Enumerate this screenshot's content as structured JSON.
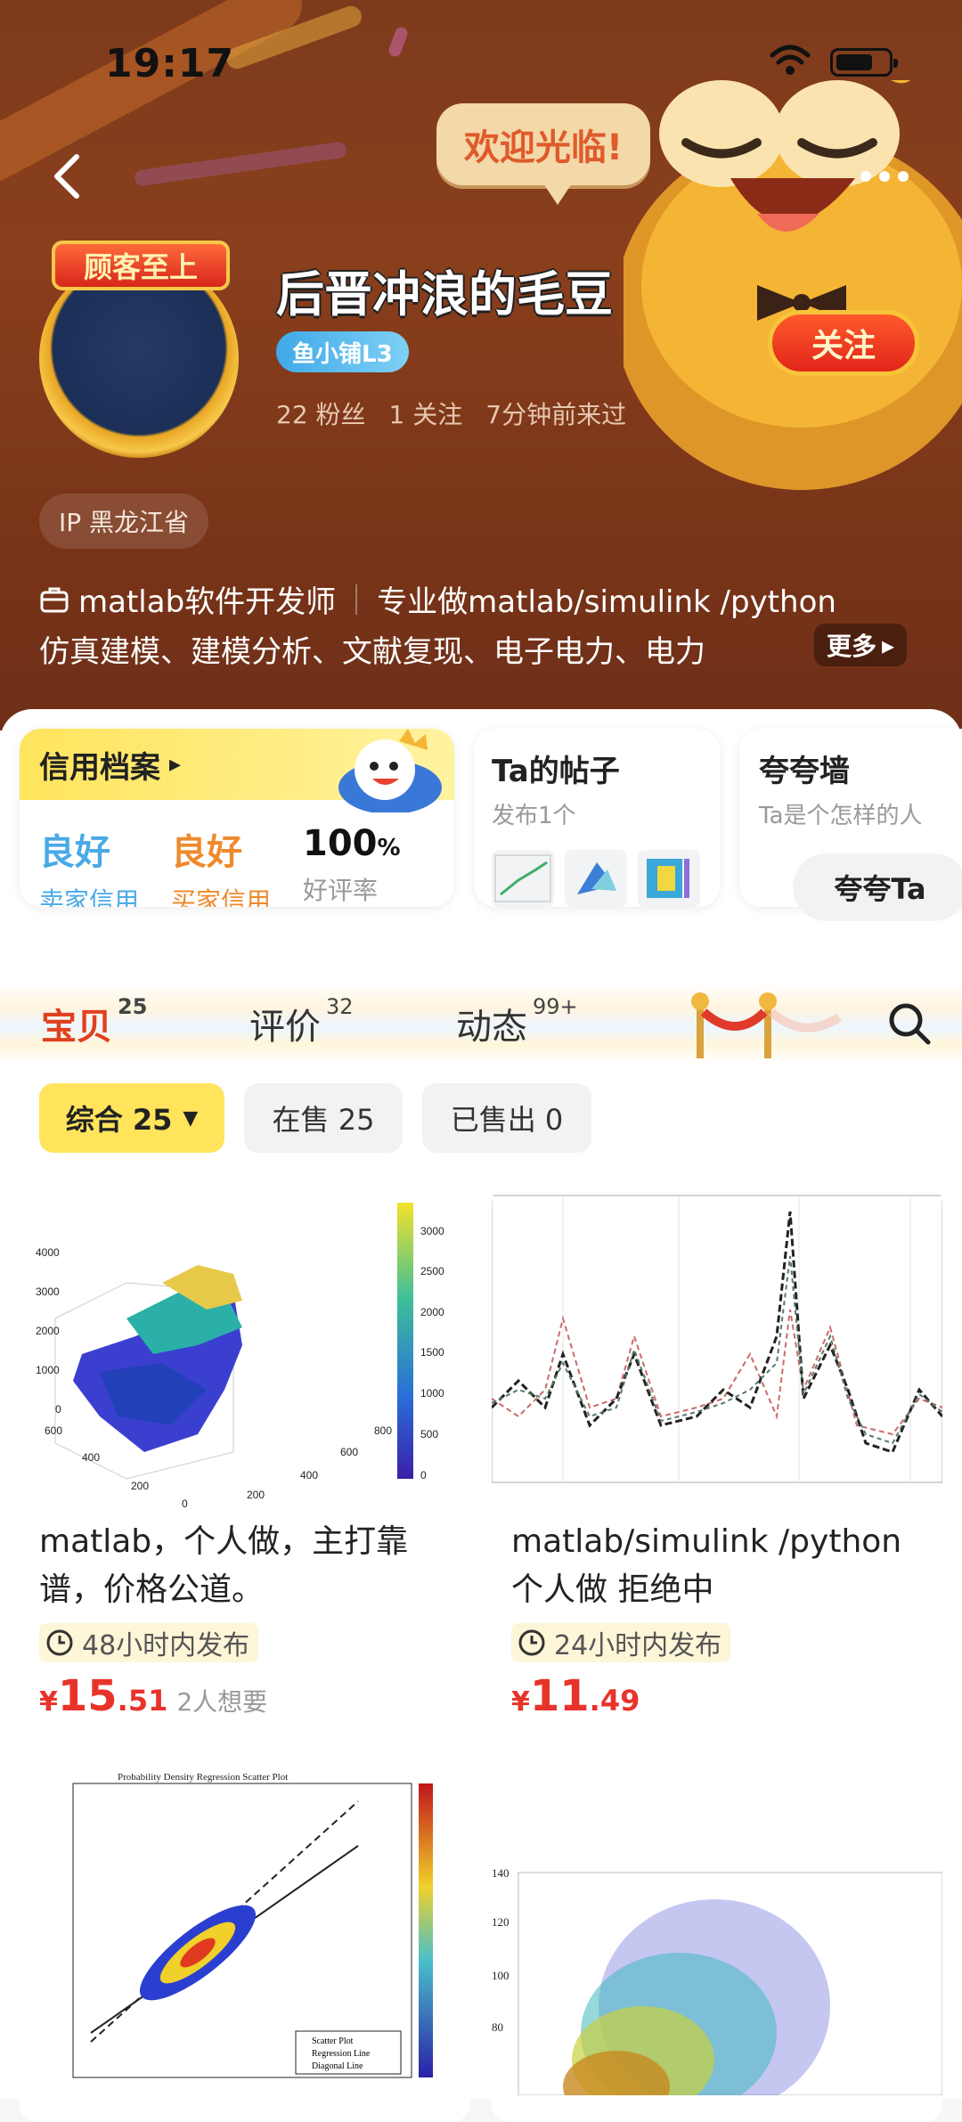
{
  "status_bar": {
    "time": "19:17"
  },
  "header": {
    "welcome": "欢迎光临!",
    "avatar_tag": "顾客至上",
    "nickname": "后晋冲浪的毛豆",
    "level": "鱼小铺L3",
    "follow": "关注",
    "stats": {
      "fans": "22 粉丝",
      "following": "1 关注",
      "last_seen": "7分钟前来过"
    },
    "ip": "IP 黑龙江省",
    "bio_job": "matlab软件开发师",
    "bio_line1": "专业做matlab/simulink /python",
    "bio_line2": "仿真建模、建模分析、文献复现、电子电力、电力",
    "more": "更多"
  },
  "cards": {
    "credit": {
      "title": "信用档案",
      "seller_value": "良好",
      "seller_label": "卖家信用",
      "buyer_value": "良好",
      "buyer_label": "买家信用",
      "rating_value": "100",
      "rating_unit": "%",
      "rating_label": "好评率",
      "colors": {
        "seller": "#4aa9e6",
        "buyer": "#ee8a2c"
      }
    },
    "posts": {
      "title": "Ta的帖子",
      "subtitle": "发布1个"
    },
    "praise": {
      "title": "夸夸墙",
      "subtitle": "Ta是个怎样的人",
      "button": "夸夸Ta"
    }
  },
  "tabs": [
    {
      "label": "宝贝",
      "count": "25"
    },
    {
      "label": "评价",
      "count": "32"
    },
    {
      "label": "动态",
      "count": "99+"
    }
  ],
  "filters": [
    {
      "label": "综合 25"
    },
    {
      "label": "在售 25"
    },
    {
      "label": "已售出 0"
    }
  ],
  "products": [
    {
      "title": "matlab，个人做，主打靠谱，价格公道。",
      "time_tag": "48小时内发布",
      "price_yen": "¥",
      "price_int": "15",
      "price_dec": ".51",
      "want": "2人想要"
    },
    {
      "title": "matlab/simulink /python 个人做 拒绝中",
      "time_tag": "24小时内发布",
      "price_yen": "¥",
      "price_int": "11",
      "price_dec": ".49",
      "want": ""
    },
    {
      "title": "",
      "time_tag": "",
      "price_int": "",
      "price_dec": "",
      "want": ""
    },
    {
      "title": "",
      "time_tag": "",
      "price_int": "",
      "price_dec": "",
      "want": ""
    }
  ],
  "plot_labels": {
    "p1_axes": [
      "4000",
      "3000",
      "2000",
      "1000",
      "0",
      "600",
      "400",
      "200",
      "0",
      "200",
      "400",
      "600",
      "800"
    ],
    "p1_colorbar": [
      "3000",
      "2500",
      "2000",
      "1500",
      "1000",
      "500",
      "0"
    ],
    "p3_title": "Probability Density Regression Scatter Plot",
    "p3_legend": [
      "Scatter Plot",
      "Regression Line",
      "Diagonal Line"
    ],
    "p4_yticks": [
      "140",
      "120",
      "100",
      "80"
    ]
  }
}
